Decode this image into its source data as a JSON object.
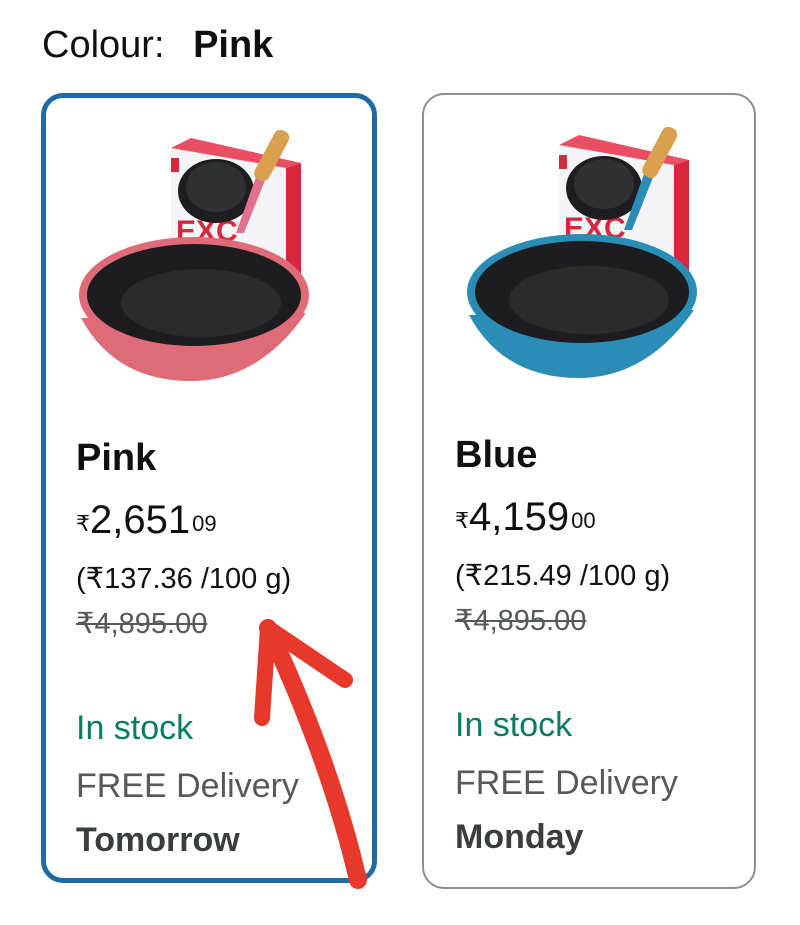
{
  "colour": {
    "label": "Colour:",
    "value": "Pink"
  },
  "options": [
    {
      "name": "Pink",
      "currency": "₹",
      "price_whole": "2,651",
      "price_fraction": "09",
      "unit_price": "(₹137.36 /100 g)",
      "mrp": "₹4,895.00",
      "stock": "In stock",
      "delivery": "FREE Delivery",
      "delivery_day": "Tomorrow",
      "selected": true,
      "pan_color": "#e06b78",
      "handle_color": "#e0718c"
    },
    {
      "name": "Blue",
      "currency": "₹",
      "price_whole": "4,159",
      "price_fraction": "00",
      "unit_price": "(₹215.49 /100 g)",
      "mrp": "₹4,895.00",
      "stock": "In stock",
      "delivery": "FREE Delivery",
      "delivery_day": "Monday",
      "selected": false,
      "pan_color": "#2a8db5",
      "handle_color": "#2a8db5"
    }
  ],
  "colors": {
    "selected_border": "#1f6aa5",
    "in_stock": "#067d62",
    "annotation_arrow": "#e8382b"
  },
  "box_brand_text": "EXC"
}
